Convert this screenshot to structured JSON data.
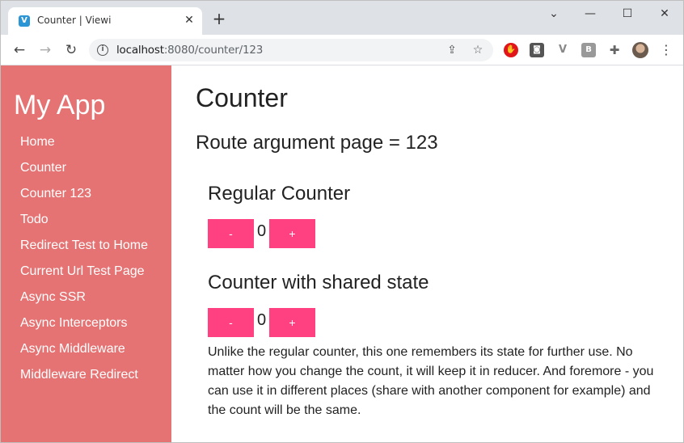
{
  "browser": {
    "tab_title": "Counter | Viewi",
    "favicon_letter": "V",
    "new_tab": "+",
    "close_tab": "✕",
    "window_controls": {
      "chevron": "⌄",
      "minimize": "—",
      "maximize": "☐",
      "close": "✕"
    },
    "url_host": "localhost",
    "url_rest": ":8080/counter/123",
    "nav": {
      "back": "←",
      "forward": "→",
      "reload": "↻"
    },
    "info_icon": "i",
    "share_icon": "⇪",
    "star_icon": "☆",
    "extensions": [
      {
        "name": "adblock-extension-icon",
        "glyph": "✋"
      },
      {
        "name": "screen-capture-extension-icon",
        "glyph": "◙"
      },
      {
        "name": "vue-devtools-extension-icon",
        "glyph": "V"
      },
      {
        "name": "b-extension-icon",
        "glyph": "B"
      },
      {
        "name": "extensions-puzzle-icon",
        "glyph": "✚"
      }
    ],
    "menu": "⋮"
  },
  "sidebar": {
    "app_title": "My App",
    "items": [
      {
        "label": "Home"
      },
      {
        "label": "Counter"
      },
      {
        "label": "Counter 123"
      },
      {
        "label": "Todo"
      },
      {
        "label": "Redirect Test to Home"
      },
      {
        "label": "Current Url Test Page"
      },
      {
        "label": "Async SSR"
      },
      {
        "label": "Async Interceptors"
      },
      {
        "label": "Async Middleware"
      },
      {
        "label": "Middleware Redirect"
      }
    ]
  },
  "main": {
    "title": "Counter",
    "route_argument": "Route argument page = 123",
    "regular_counter": {
      "title": "Regular Counter",
      "decrement_label": "-",
      "value": "0",
      "increment_label": "+"
    },
    "shared_counter": {
      "title": "Counter with shared state",
      "decrement_label": "-",
      "value": "0",
      "increment_label": "+"
    },
    "description": "Unlike the regular counter, this one remembers its state for further use. No matter how you change the count, it will keep it in reducer. And foremore - you can use it in different places (share with another component for example) and the count will be the same."
  },
  "colors": {
    "sidebar_bg": "#e57373",
    "button_bg": "#ff4081"
  }
}
